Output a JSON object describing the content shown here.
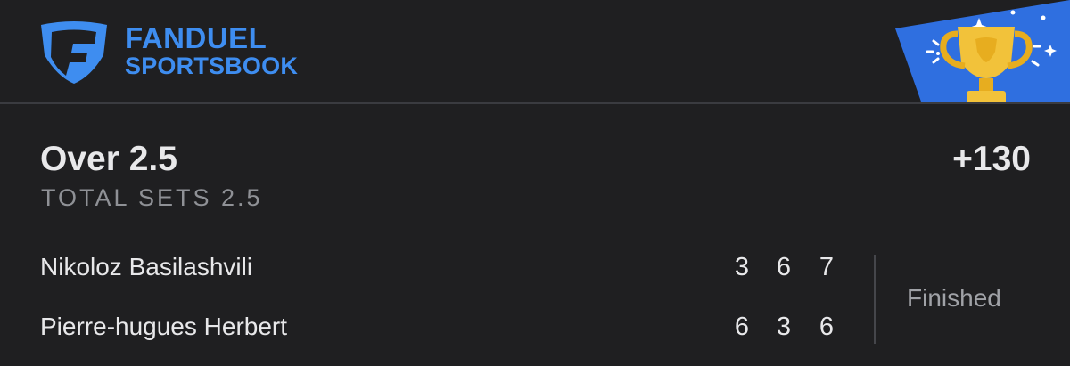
{
  "header": {
    "brand_line1": "FANDUEL",
    "brand_line2": "SPORTSBOOK",
    "logo_icon": "fanduel-shield-logo-icon",
    "badge_icon": "trophy-icon"
  },
  "bet": {
    "selection": "Over 2.5",
    "market": "TOTAL SETS 2.5",
    "odds": "+130"
  },
  "match": {
    "players": [
      {
        "name": "Nikoloz Basilashvili",
        "sets": [
          "3",
          "6",
          "7"
        ]
      },
      {
        "name": "Pierre-hugues Herbert",
        "sets": [
          "6",
          "3",
          "6"
        ]
      }
    ],
    "status": "Finished"
  },
  "colors": {
    "background": "#1f1f21",
    "brand_blue": "#3e8df0",
    "badge_blue": "#2f6fe0",
    "trophy_gold": "#f2c23a",
    "text_primary": "#e8e8ea",
    "text_secondary": "#8f9196"
  }
}
